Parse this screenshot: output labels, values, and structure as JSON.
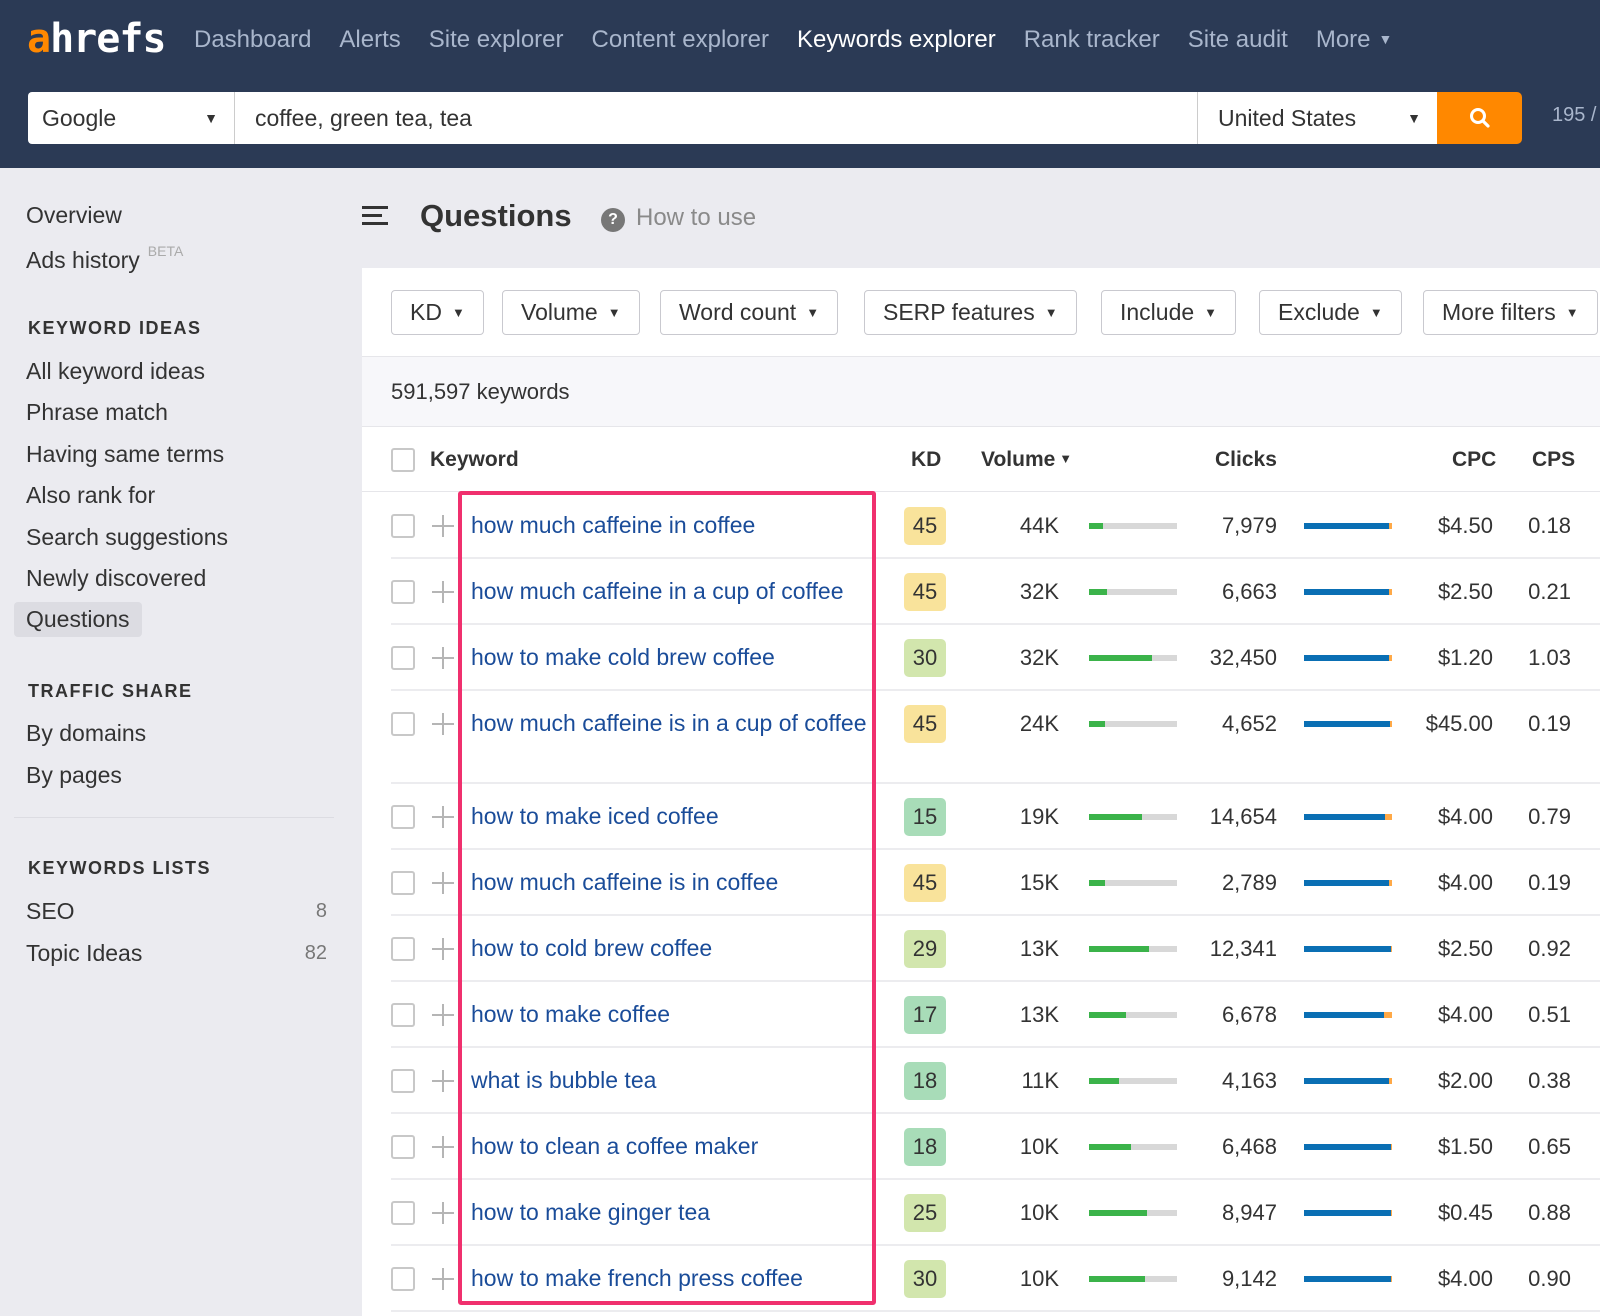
{
  "app": {
    "logo_accent": "a",
    "logo_rest": "hrefs",
    "brand_color": "#ff8800"
  },
  "nav": {
    "items": [
      {
        "label": "Dashboard",
        "active": false
      },
      {
        "label": "Alerts",
        "active": false
      },
      {
        "label": "Site explorer",
        "active": false
      },
      {
        "label": "Content explorer",
        "active": false
      },
      {
        "label": "Keywords explorer",
        "active": true
      },
      {
        "label": "Rank tracker",
        "active": false
      },
      {
        "label": "Site audit",
        "active": false
      },
      {
        "label": "More",
        "active": false,
        "has_caret": true
      }
    ]
  },
  "search": {
    "engine": "Google",
    "query": "coffee, green tea, tea",
    "country": "United States",
    "search_icon": "search-icon",
    "credits": "195 /"
  },
  "sidebar": {
    "top_items": [
      {
        "label": "Overview"
      },
      {
        "label": "Ads history",
        "badge": "BETA"
      }
    ],
    "sections": [
      {
        "heading": "KEYWORD IDEAS",
        "items": [
          {
            "label": "All keyword ideas"
          },
          {
            "label": "Phrase match"
          },
          {
            "label": "Having same terms"
          },
          {
            "label": "Also rank for"
          },
          {
            "label": "Search suggestions"
          },
          {
            "label": "Newly discovered"
          },
          {
            "label": "Questions",
            "selected": true
          }
        ]
      },
      {
        "heading": "TRAFFIC SHARE",
        "items": [
          {
            "label": "By domains"
          },
          {
            "label": "By pages"
          }
        ]
      },
      {
        "heading": "KEYWORDS LISTS",
        "items": [
          {
            "label": "SEO",
            "count": "8"
          },
          {
            "label": "Topic Ideas",
            "count": "82"
          }
        ]
      }
    ]
  },
  "header": {
    "title": "Questions",
    "help_label": "How to use",
    "help_icon": "?"
  },
  "filters": [
    {
      "label": "KD"
    },
    {
      "label": "Volume"
    },
    {
      "label": "Word count"
    },
    {
      "label": "SERP features"
    },
    {
      "label": "Include"
    },
    {
      "label": "Exclude"
    },
    {
      "label": "More filters"
    }
  ],
  "results": {
    "count_label": "591,597 keywords"
  },
  "table": {
    "columns": {
      "keyword": "Keyword",
      "kd": "KD",
      "volume": "Volume",
      "clicks": "Clicks",
      "cpc": "CPC",
      "cps": "CPS"
    },
    "sorted_by": "volume",
    "kd_colors": {
      "easy": "#a8dcb8",
      "medium": "#d2e6ad",
      "hard": "#f9e39b"
    },
    "rows": [
      {
        "keyword": "how much caffeine in coffee",
        "kd": "45",
        "kd_level": "hard",
        "volume": "44K",
        "volume_bar": 0.16,
        "clicks": "7,979",
        "clicks_organic": 0.97,
        "cpc": "$4.50",
        "cps": "0.18"
      },
      {
        "keyword": "how much caffeine in a cup of coffee",
        "kd": "45",
        "kd_level": "hard",
        "volume": "32K",
        "volume_bar": 0.2,
        "clicks": "6,663",
        "clicks_organic": 0.97,
        "cpc": "$2.50",
        "cps": "0.21"
      },
      {
        "keyword": "how to make cold brew coffee",
        "kd": "30",
        "kd_level": "medium",
        "volume": "32K",
        "volume_bar": 0.72,
        "clicks": "32,450",
        "clicks_organic": 0.97,
        "cpc": "$1.20",
        "cps": "1.03"
      },
      {
        "keyword": "how much caffeine is in a cup of coffee",
        "kd": "45",
        "kd_level": "hard",
        "volume": "24K",
        "volume_bar": 0.18,
        "clicks": "4,652",
        "clicks_organic": 0.98,
        "cpc": "$45.00",
        "cps": "0.19"
      },
      {
        "keyword": "how to make iced coffee",
        "kd": "15",
        "kd_level": "easy",
        "volume": "19K",
        "volume_bar": 0.6,
        "clicks": "14,654",
        "clicks_organic": 0.92,
        "cpc": "$4.00",
        "cps": "0.79"
      },
      {
        "keyword": "how much caffeine is in coffee",
        "kd": "45",
        "kd_level": "hard",
        "volume": "15K",
        "volume_bar": 0.18,
        "clicks": "2,789",
        "clicks_organic": 0.97,
        "cpc": "$4.00",
        "cps": "0.19"
      },
      {
        "keyword": "how to cold brew coffee",
        "kd": "29",
        "kd_level": "medium",
        "volume": "13K",
        "volume_bar": 0.68,
        "clicks": "12,341",
        "clicks_organic": 0.99,
        "cpc": "$2.50",
        "cps": "0.92"
      },
      {
        "keyword": "how to make coffee",
        "kd": "17",
        "kd_level": "easy",
        "volume": "13K",
        "volume_bar": 0.42,
        "clicks": "6,678",
        "clicks_organic": 0.91,
        "cpc": "$4.00",
        "cps": "0.51"
      },
      {
        "keyword": "what is bubble tea",
        "kd": "18",
        "kd_level": "easy",
        "volume": "11K",
        "volume_bar": 0.34,
        "clicks": "4,163",
        "clicks_organic": 0.97,
        "cpc": "$2.00",
        "cps": "0.38"
      },
      {
        "keyword": "how to clean a coffee maker",
        "kd": "18",
        "kd_level": "easy",
        "volume": "10K",
        "volume_bar": 0.48,
        "clicks": "6,468",
        "clicks_organic": 0.99,
        "cpc": "$1.50",
        "cps": "0.65"
      },
      {
        "keyword": "how to make ginger tea",
        "kd": "25",
        "kd_level": "medium",
        "volume": "10K",
        "volume_bar": 0.66,
        "clicks": "8,947",
        "clicks_organic": 0.99,
        "cpc": "$0.45",
        "cps": "0.88"
      },
      {
        "keyword": "how to make french press coffee",
        "kd": "30",
        "kd_level": "medium",
        "volume": "10K",
        "volume_bar": 0.64,
        "clicks": "9,142",
        "clicks_organic": 0.99,
        "cpc": "$4.00",
        "cps": "0.90"
      }
    ]
  },
  "annotation": {
    "highlight_color": "#f0306e",
    "highlights": "keyword column"
  }
}
